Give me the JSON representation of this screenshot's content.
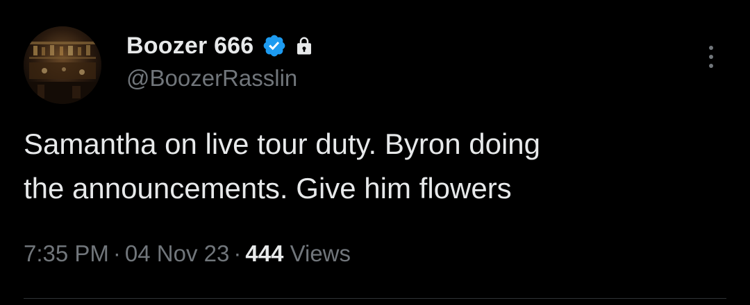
{
  "author": {
    "display_name": "Boozer 666",
    "handle": "@BoozerRasslin",
    "verified": true,
    "protected": true,
    "verified_color": "#1d9bf0"
  },
  "icons": {
    "avatar": "bar-interior-photo",
    "verified": "verified-badge-icon",
    "lock": "lock-icon",
    "more": "more-vertical-icon"
  },
  "tweet": {
    "line1": "Samantha on live tour duty. Byron doing",
    "line2": "the announcements. Give him flowers"
  },
  "meta": {
    "time": "7:35 PM",
    "separator": "·",
    "date": "04 Nov 23",
    "views_count": "444",
    "views_label": "Views"
  },
  "colors": {
    "background": "#000000",
    "primary_text": "#e7e9ea",
    "secondary_text": "#71767b",
    "divider": "#2f3336"
  }
}
